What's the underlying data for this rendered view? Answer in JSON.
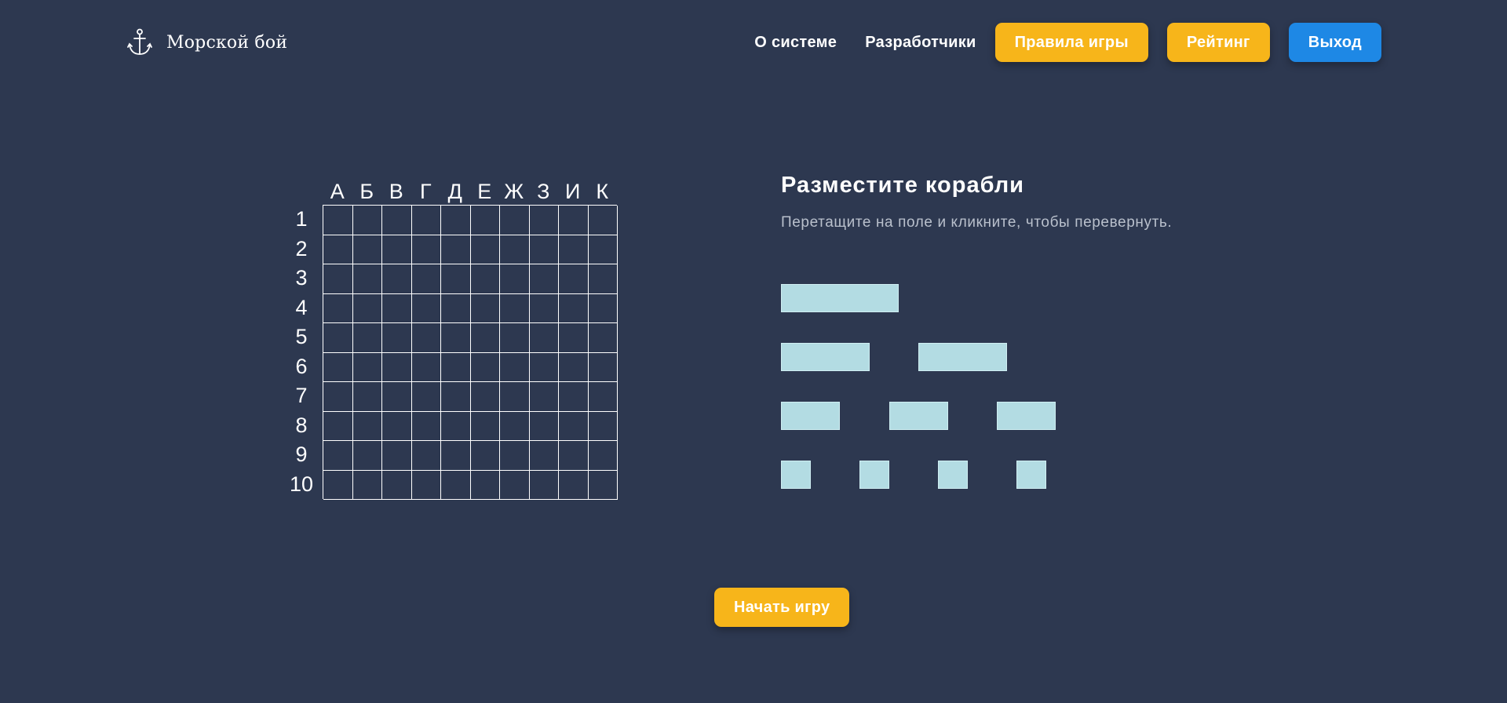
{
  "header": {
    "logo_text": "Морской бой",
    "logo_icon": "anchor-icon",
    "nav_links": [
      "О системе",
      "Разработчики"
    ],
    "buttons": {
      "rules": "Правила игры",
      "rating": "Рейтинг",
      "exit": "Выход"
    }
  },
  "board": {
    "columns": [
      "А",
      "Б",
      "В",
      "Г",
      "Д",
      "Е",
      "Ж",
      "З",
      "И",
      "К"
    ],
    "rows": [
      "1",
      "2",
      "3",
      "4",
      "5",
      "6",
      "7",
      "8",
      "9",
      "10"
    ]
  },
  "ships_panel": {
    "title": "Разместите корабли",
    "subtitle": "Перетащите на поле и кликните, чтобы перевернуть.",
    "ships": [
      {
        "size": 4
      },
      {
        "size": 3
      },
      {
        "size": 3
      },
      {
        "size": 2
      },
      {
        "size": 2
      },
      {
        "size": 2
      },
      {
        "size": 1
      },
      {
        "size": 1
      },
      {
        "size": 1
      },
      {
        "size": 1
      }
    ]
  },
  "start_button": "Начать игру",
  "colors": {
    "background": "#2d3850",
    "accent_yellow": "#f7b51a",
    "accent_blue": "#1e88e5",
    "ship": "#b3dce3"
  }
}
